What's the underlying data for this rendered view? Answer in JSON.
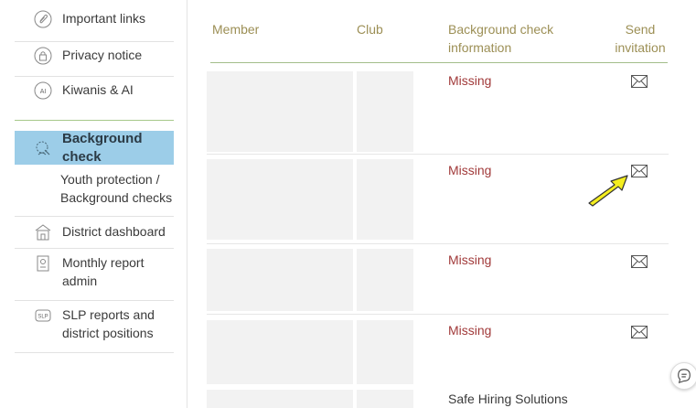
{
  "sidebar": {
    "items": [
      {
        "label": "Important links",
        "icon": "paperclip-icon"
      },
      {
        "label": "Privacy notice",
        "icon": "lock-icon"
      },
      {
        "label": "Kiwanis & AI",
        "icon": "ai-badge-icon"
      }
    ],
    "active": {
      "label": "Background check",
      "icon": "background-check-icon"
    },
    "sub_item": {
      "label": "Youth protection / Background checks"
    },
    "items_after": [
      {
        "label": "District dashboard",
        "icon": "building-icon"
      },
      {
        "label": "Monthly report admin",
        "icon": "report-icon"
      },
      {
        "label": "SLP reports and district positions",
        "icon": "slp-icon"
      }
    ],
    "ai_badge_text": "AI",
    "slp_badge_text": "SLP"
  },
  "table": {
    "headers": {
      "member": "Member",
      "club": "Club",
      "bgcheck": "Background check information",
      "send": "Send invitation"
    },
    "rows": [
      {
        "status": "Missing"
      },
      {
        "status": "Missing"
      },
      {
        "status": "Missing"
      },
      {
        "status": "Missing"
      },
      {
        "status": "Safe Hiring Solutions"
      }
    ]
  },
  "colors": {
    "accent_active": "#9ccde8",
    "status_missing": "#a13a3a",
    "header_text": "#9c8f55",
    "arrow": "#f4ee1f"
  }
}
